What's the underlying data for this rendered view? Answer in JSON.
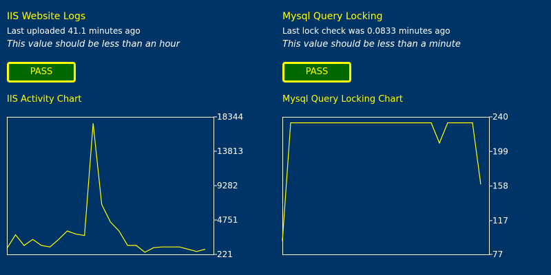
{
  "colors": {
    "background": "#003366",
    "accent": "#FFFF00",
    "text": "#FFFFFF",
    "pass_bg": "#006600"
  },
  "panels": [
    {
      "title": "IIS Website Logs",
      "status": "Last uploaded 41.1 minutes ago",
      "note": "This value should be less than an hour",
      "button_label": "PASS",
      "chart_title": "IIS Activity Chart"
    },
    {
      "title": "Mysql Query Locking",
      "status": "Last lock check was 0.0833 minutes ago",
      "note": "This value should be less than a minute",
      "button_label": "PASS",
      "chart_title": "Mysql Query Locking Chart"
    }
  ],
  "chart_data": [
    {
      "type": "line",
      "title": "IIS Activity Chart",
      "ylim": [
        221,
        18344
      ],
      "y_ticks": [
        "18344",
        "13813",
        "9282",
        "4751",
        "221"
      ],
      "y_tick_values": [
        18344,
        13813,
        9282,
        4751,
        221
      ],
      "grid": false,
      "values": [
        1000,
        2800,
        1400,
        2200,
        1400,
        1200,
        2200,
        3300,
        2900,
        2700,
        17500,
        6800,
        4500,
        3300,
        1400,
        1400,
        500,
        1100,
        1200,
        1200,
        1200,
        900,
        600,
        900
      ]
    },
    {
      "type": "line",
      "title": "Mysql Query Locking Chart",
      "ylim": [
        77,
        240
      ],
      "y_ticks": [
        "240",
        "199",
        "158",
        "117",
        "77"
      ],
      "y_tick_values": [
        240,
        199,
        158,
        117,
        77
      ],
      "grid": false,
      "values": [
        93,
        233,
        233,
        233,
        233,
        233,
        233,
        233,
        233,
        233,
        233,
        233,
        233,
        233,
        233,
        233,
        233,
        233,
        233,
        209,
        233,
        233,
        233,
        233,
        160
      ]
    }
  ]
}
